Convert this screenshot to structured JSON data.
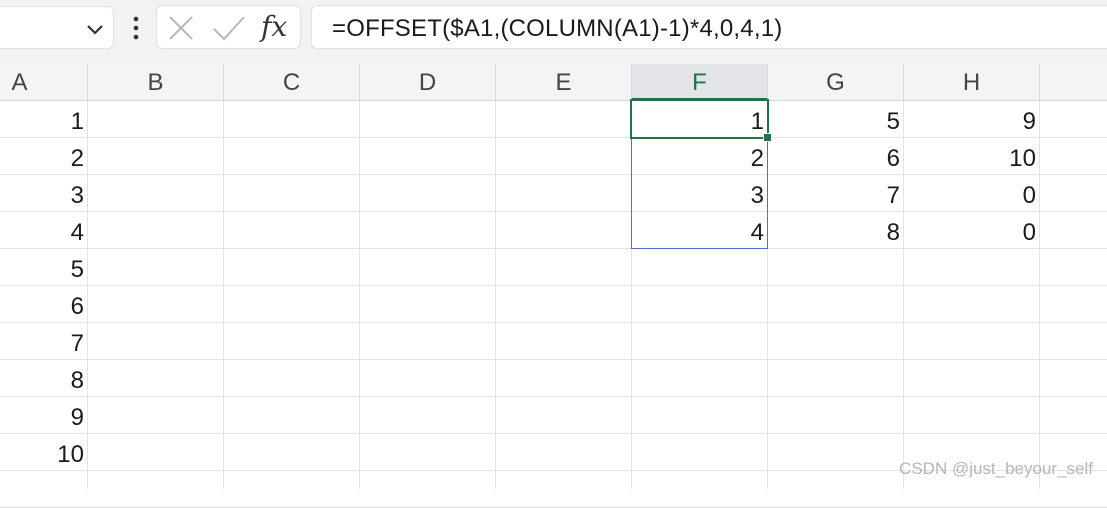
{
  "name_box": {
    "value": ""
  },
  "formula_bar": {
    "cancel_icon": "x-icon",
    "confirm_icon": "check-icon",
    "fx_label": "fx",
    "formula": "=OFFSET($A1,(COLUMN(A1)-1)*4,0,4,1)"
  },
  "columns": [
    "A",
    "B",
    "C",
    "D",
    "E",
    "F",
    "G",
    "H"
  ],
  "selected_column": "F",
  "rows": [
    {
      "A": "1",
      "F": "1",
      "G": "5",
      "H": "9"
    },
    {
      "A": "2",
      "F": "2",
      "G": "6",
      "H": "10"
    },
    {
      "A": "3",
      "F": "3",
      "G": "7",
      "H": "0"
    },
    {
      "A": "4",
      "F": "4",
      "G": "8",
      "H": "0"
    },
    {
      "A": "5"
    },
    {
      "A": "6"
    },
    {
      "A": "7"
    },
    {
      "A": "8"
    },
    {
      "A": "9"
    },
    {
      "A": "10"
    }
  ],
  "active_cell": "F1",
  "selected_range": "F1:F4",
  "colors": {
    "accent": "#217346",
    "selection_border": "#4a73c8"
  },
  "watermark": "CSDN @just_beyour_self"
}
